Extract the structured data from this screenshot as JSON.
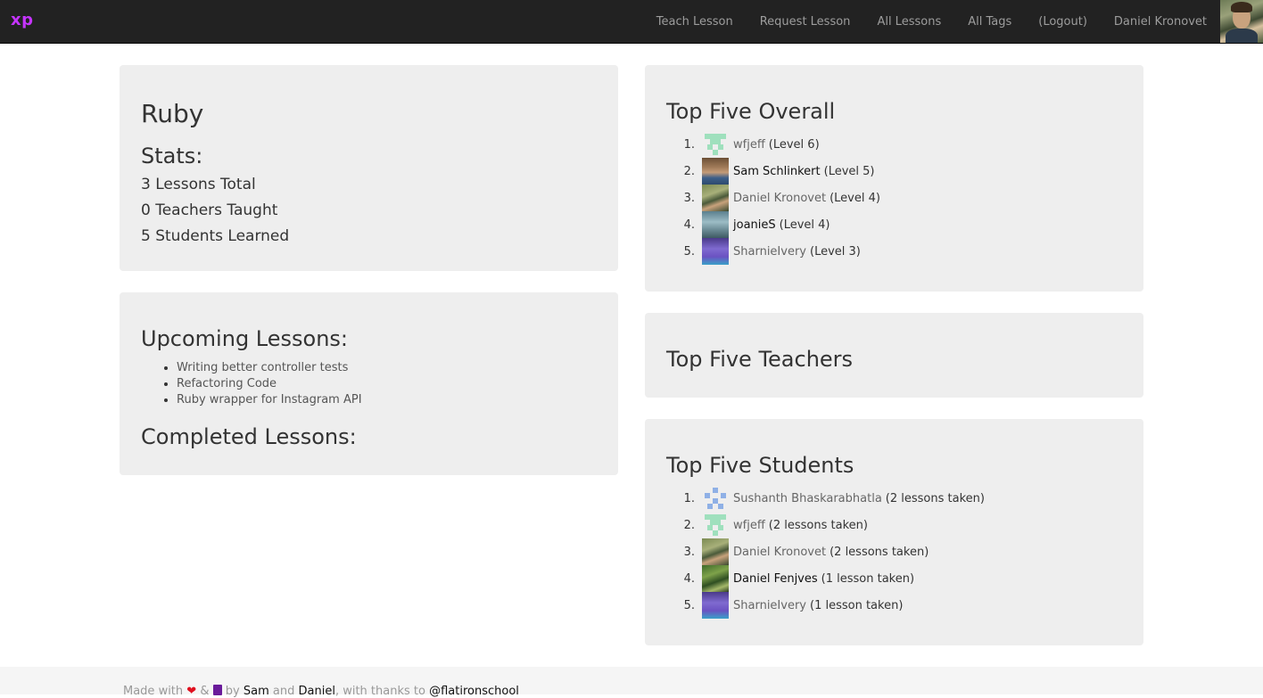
{
  "nav": {
    "brand": "xp",
    "links": [
      "Teach Lesson",
      "Request Lesson",
      "All Lessons",
      "All Tags",
      "(Logout)",
      "Daniel Kronovet"
    ]
  },
  "tag": {
    "name": "Ruby",
    "stats_heading": "Stats:",
    "stats": [
      "3 Lessons Total",
      "0 Teachers Taught",
      "5 Students Learned"
    ]
  },
  "lessons": {
    "upcoming_heading": "Upcoming Lessons:",
    "upcoming": [
      "Writing better controller tests",
      "Refactoring Code",
      "Ruby wrapper for Instagram API"
    ],
    "completed_heading": "Completed Lessons:"
  },
  "top_overall": {
    "heading": "Top Five Overall",
    "items": [
      {
        "num": "1.",
        "name": "wfjeff",
        "meta": "(Level 6)",
        "avatar": "identicon-green"
      },
      {
        "num": "2.",
        "name": "Sam Schlinkert",
        "meta": "(Level 5)",
        "avatar": "photo-sam"
      },
      {
        "num": "3.",
        "name": "Daniel Kronovet",
        "meta": "(Level 4)",
        "avatar": "photo-daniel"
      },
      {
        "num": "4.",
        "name": "joanieS",
        "meta": "(Level 4)",
        "avatar": "photo-joanie"
      },
      {
        "num": "5.",
        "name": "SharnieIvery",
        "meta": "(Level 3)",
        "avatar": "photo-sharnie"
      }
    ]
  },
  "top_teachers": {
    "heading": "Top Five Teachers"
  },
  "top_students": {
    "heading": "Top Five Students",
    "items": [
      {
        "num": "1.",
        "name": "Sushanth Bhaskarabhatla",
        "meta": "(2 lessons taken)",
        "avatar": "identicon-blue"
      },
      {
        "num": "2.",
        "name": "wfjeff",
        "meta": "(2 lessons taken)",
        "avatar": "identicon-green"
      },
      {
        "num": "3.",
        "name": "Daniel Kronovet",
        "meta": "(2 lessons taken)",
        "avatar": "photo-daniel"
      },
      {
        "num": "4.",
        "name": "Daniel Fenjves",
        "meta": "(1 lesson taken)",
        "avatar": "photo-fenjves"
      },
      {
        "num": "5.",
        "name": "SharnieIvery",
        "meta": "(1 lesson taken)",
        "avatar": "photo-sharnie"
      }
    ]
  },
  "footer": {
    "made_with": "Made with",
    "heart": "❤",
    "amp": "&",
    "by": "by",
    "sam": "Sam",
    "and": "and",
    "daniel": "Daniel",
    "thanks": ", with thanks to",
    "school": "@flatironschool"
  },
  "colors": {
    "navbar": "#222222",
    "brand": "#c534ff",
    "panel": "#eeeeee"
  }
}
